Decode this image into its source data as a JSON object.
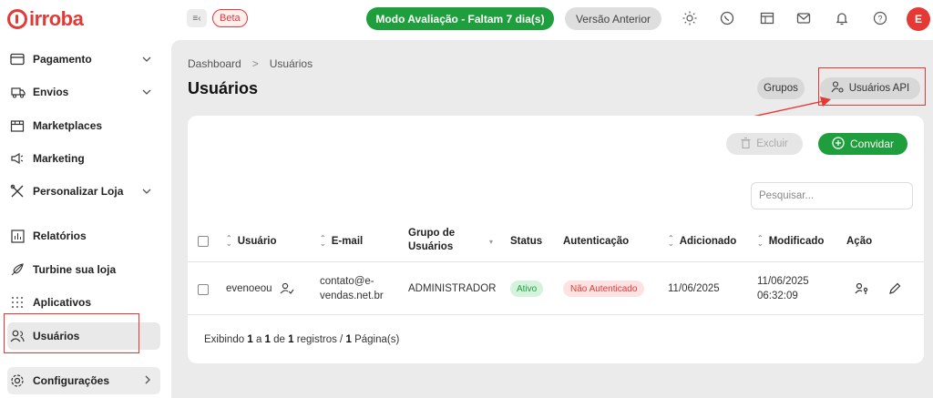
{
  "brand": {
    "name": "irroba",
    "color": "#e53935"
  },
  "header": {
    "beta_label": "Beta",
    "trial_label": "Modo Avaliação - Faltam 7 dia(s)",
    "previous_version_label": "Versão Anterior",
    "avatar_initial": "E",
    "icons": [
      "sun-icon",
      "whatsapp-icon",
      "calendar-icon",
      "mail-icon",
      "bell-icon",
      "help-icon"
    ]
  },
  "sidebar": {
    "items": [
      {
        "label": "Pagamento",
        "icon": "card-icon",
        "has_chevron": true
      },
      {
        "label": "Envios",
        "icon": "truck-icon",
        "has_chevron": true
      },
      {
        "label": "Marketplaces",
        "icon": "store-icon",
        "has_chevron": false
      },
      {
        "label": "Marketing",
        "icon": "megaphone-icon",
        "has_chevron": false
      },
      {
        "label": "Personalizar Loja",
        "icon": "tools-icon",
        "has_chevron": true
      },
      {
        "label": "Relatórios",
        "icon": "chart-icon",
        "has_chevron": false
      },
      {
        "label": "Turbine sua loja",
        "icon": "rocket-icon",
        "has_chevron": false
      },
      {
        "label": "Aplicativos",
        "icon": "grid-icon",
        "has_chevron": false
      },
      {
        "label": "Usuários",
        "icon": "users-icon",
        "has_chevron": false,
        "active": true
      },
      {
        "label": "Configurações",
        "icon": "gear-icon",
        "has_chevron": true
      }
    ]
  },
  "breadcrumb": {
    "root": "Dashboard",
    "separator": ">",
    "current": "Usuários"
  },
  "page": {
    "title": "Usuários",
    "groups_button": "Grupos",
    "api_users_button": "Usuários API"
  },
  "toolbar": {
    "delete_label": "Excluir",
    "invite_label": "Convidar",
    "search_placeholder": "Pesquisar..."
  },
  "table": {
    "headers": {
      "user": "Usuário",
      "email": "E-mail",
      "group_line1": "Grupo de",
      "group_line2": "Usuários",
      "status": "Status",
      "auth": "Autenticação",
      "added": "Adicionado",
      "modified": "Modificado",
      "action": "Ação"
    },
    "rows": [
      {
        "user": "evenoeou",
        "email_line1": "contato@e-",
        "email_line2": "vendas.net.br",
        "group": "ADMINISTRADOR",
        "status": "Ativo",
        "auth": "Não Autenticado",
        "added": "11/06/2025",
        "modified_date": "11/06/2025",
        "modified_time": "06:32:09"
      }
    ]
  },
  "footer": {
    "prefix": "Exibindo",
    "from": "1",
    "a": "a",
    "to": "1",
    "de": "de",
    "total": "1",
    "registros": "registros /",
    "pages": "1",
    "pagina": "Página(s)"
  }
}
